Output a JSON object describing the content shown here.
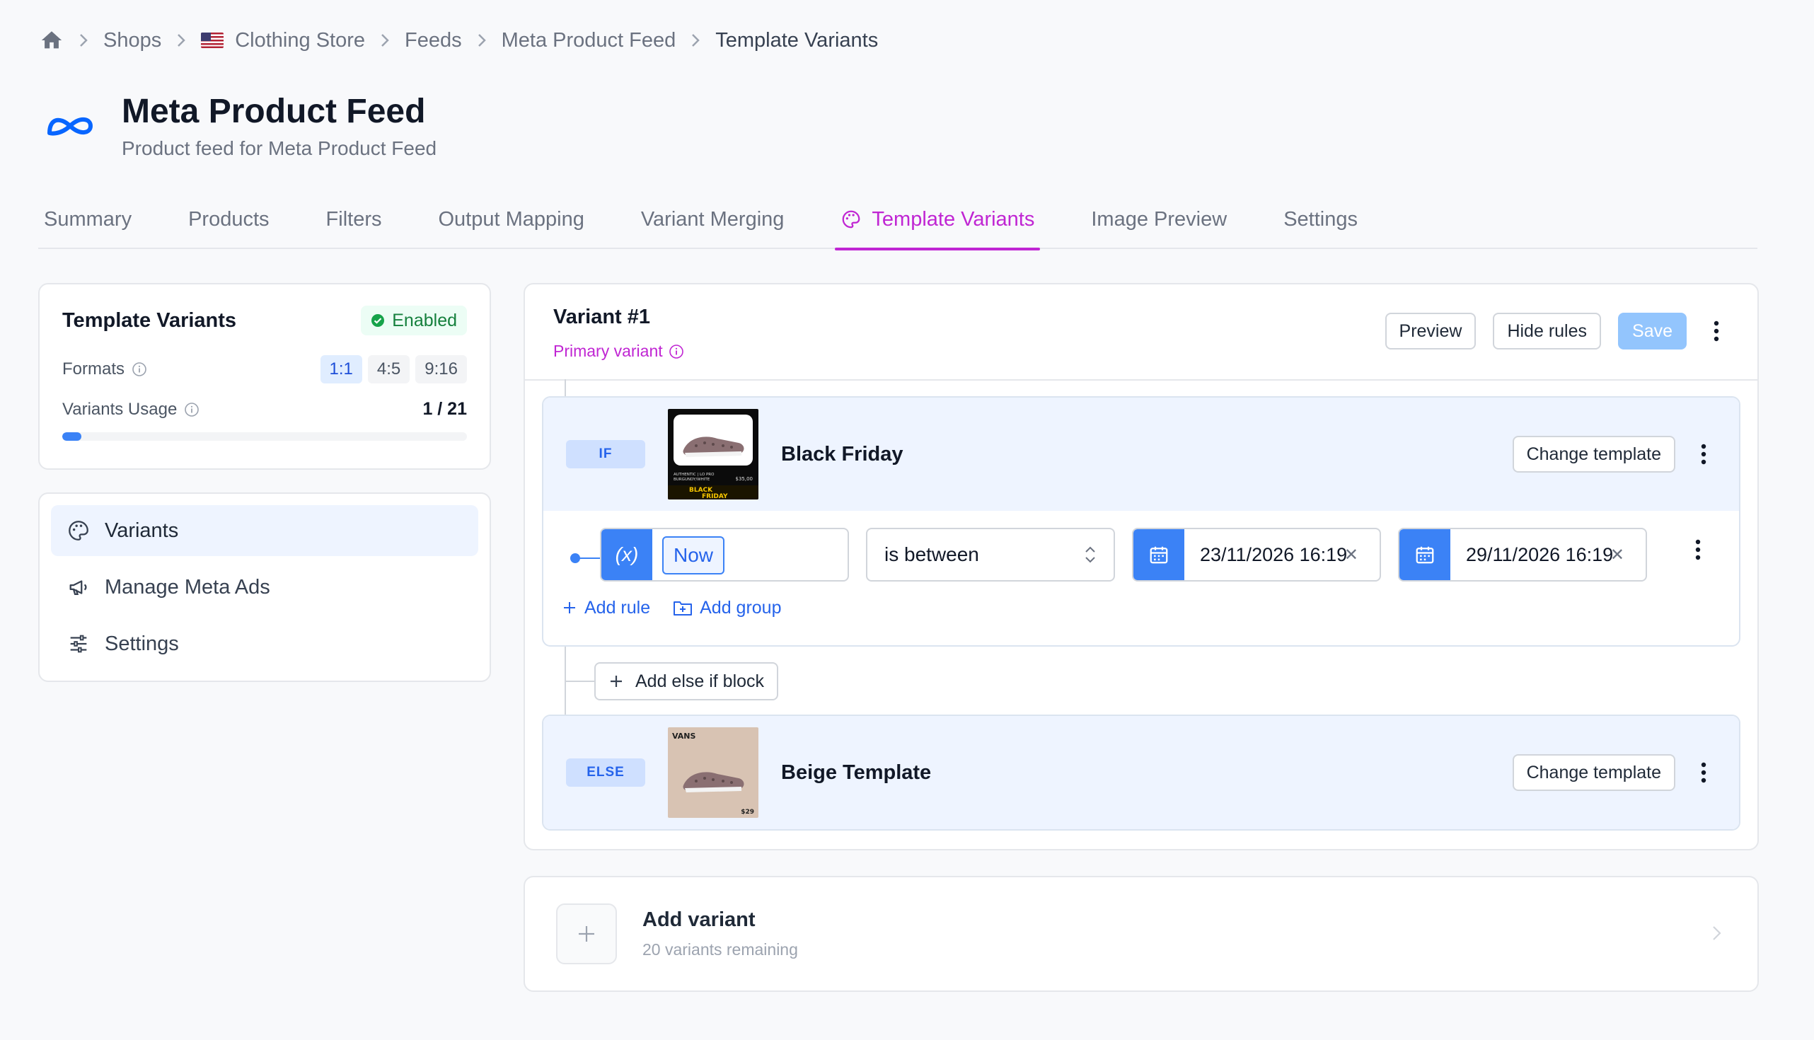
{
  "breadcrumb": {
    "items": [
      "Shops",
      "Clothing Store",
      "Feeds",
      "Meta Product Feed",
      "Template Variants"
    ]
  },
  "header": {
    "title": "Meta Product Feed",
    "subtitle": "Product feed for Meta Product Feed"
  },
  "tabs": [
    {
      "label": "Summary"
    },
    {
      "label": "Products"
    },
    {
      "label": "Filters"
    },
    {
      "label": "Output Mapping"
    },
    {
      "label": "Variant Merging"
    },
    {
      "label": "Template Variants",
      "active": true
    },
    {
      "label": "Image Preview"
    },
    {
      "label": "Settings"
    }
  ],
  "sidebar": {
    "card_title": "Template Variants",
    "status": "Enabled",
    "formats_label": "Formats",
    "formats": [
      "1:1",
      "4:5",
      "9:16"
    ],
    "usage_label": "Variants Usage",
    "usage_value": "1 / 21",
    "usage_fraction": 0.0476,
    "nav": [
      {
        "label": "Variants",
        "icon": "palette-icon",
        "active": true
      },
      {
        "label": "Manage Meta Ads",
        "icon": "megaphone-icon"
      },
      {
        "label": "Settings",
        "icon": "sliders-icon"
      }
    ]
  },
  "variant": {
    "title": "Variant #1",
    "primary_label": "Primary variant",
    "preview_label": "Preview",
    "hide_rules_label": "Hide rules",
    "save_label": "Save",
    "if_block": {
      "pill": "IF",
      "template_name": "Black Friday",
      "change_template_label": "Change template",
      "thumb_text": {
        "line1": "AUTHENTIC | LO PRO",
        "line2": "BURGUNDY/WHITE",
        "price": "$35,00",
        "banner1": "BLACK",
        "banner2": "FRIDAY"
      },
      "rule": {
        "variable": "Now",
        "operator": "is between",
        "date_from": "23/11/2026 16:19",
        "date_to": "29/11/2026 16:19"
      },
      "add_rule_label": "Add rule",
      "add_group_label": "Add group"
    },
    "add_else_if_label": "Add else if block",
    "else_block": {
      "pill": "ELSE",
      "template_name": "Beige Template",
      "change_template_label": "Change template",
      "thumb_text": {
        "brand": "VANS",
        "price": "$29"
      }
    }
  },
  "add_variant": {
    "title": "Add variant",
    "subtitle": "20 variants remaining"
  },
  "colors": {
    "accent": "#c026d3",
    "primary": "#3b82f6",
    "success": "#15803d"
  }
}
